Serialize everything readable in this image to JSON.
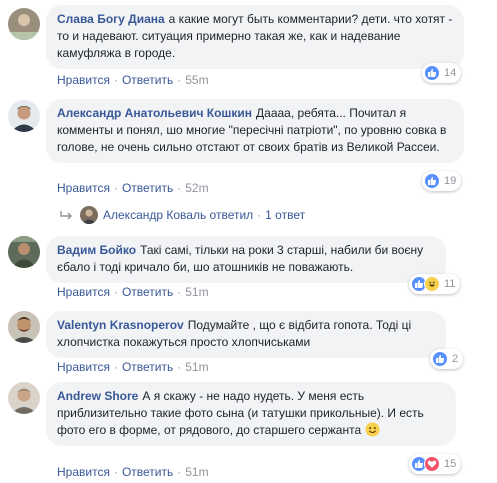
{
  "comments": [
    {
      "author": "Слава Богу Диана",
      "text": "а какие могут быть комментарии? дети. что хотят - то и надевают. ситуация примерно такая же, как и надевание камуфляжа в городе.",
      "like_label": "Нравится",
      "reply_label": "Ответить",
      "time": "55m",
      "reaction_count": "14",
      "reactions": [
        "like"
      ]
    },
    {
      "author": "Александр Анатольевич Кошкин",
      "text": "Даааа, ребята... Почитал я комменты и понял, шо многие \"пересічні патріоти\", по уровню совка в голове, не очень сильно отстают от своих братів из Великой Рассеи.",
      "like_label": "Нравится",
      "reply_label": "Ответить",
      "time": "52m",
      "reaction_count": "19",
      "reactions": [
        "like"
      ],
      "replies_author": "Александр Коваль ответил",
      "replies_count": "1 ответ"
    },
    {
      "author": "Вадим Бойко",
      "text": "Такі самі, тільки на роки 3 старші, набили би воєну єбало і тоді кричало би, шо атошників не поважають.",
      "like_label": "Нравится",
      "reply_label": "Ответить",
      "time": "51m",
      "reaction_count": "11",
      "reactions": [
        "like",
        "haha"
      ]
    },
    {
      "author": "Valentyn Krasnoperov",
      "text": "Подумайте , що є відбита гопота. Тоді ці хлопчистка покажуться просто хлопчиськами",
      "like_label": "Нравится",
      "reply_label": "Ответить",
      "time": "51m",
      "reaction_count": "2",
      "reactions": [
        "like"
      ]
    },
    {
      "author": "Andrew Shore",
      "text": "А я скажу - не надо нудеть. У меня есть приблизительно такие фото сына (и татушки прикольные). И есть фото его в форме, от рядового, до старшего сержанта",
      "emoji": "smile",
      "like_label": "Нравится",
      "reply_label": "Ответить",
      "time": "51m",
      "reaction_count": "15",
      "reactions": [
        "like",
        "love"
      ]
    }
  ],
  "colors": {
    "author": "#385898",
    "bubble": "#f2f3f5",
    "like_blue": "#5890ff",
    "meta": "#90949c",
    "love_red": "#f25268",
    "haha_yellow": "#f7d04d"
  }
}
